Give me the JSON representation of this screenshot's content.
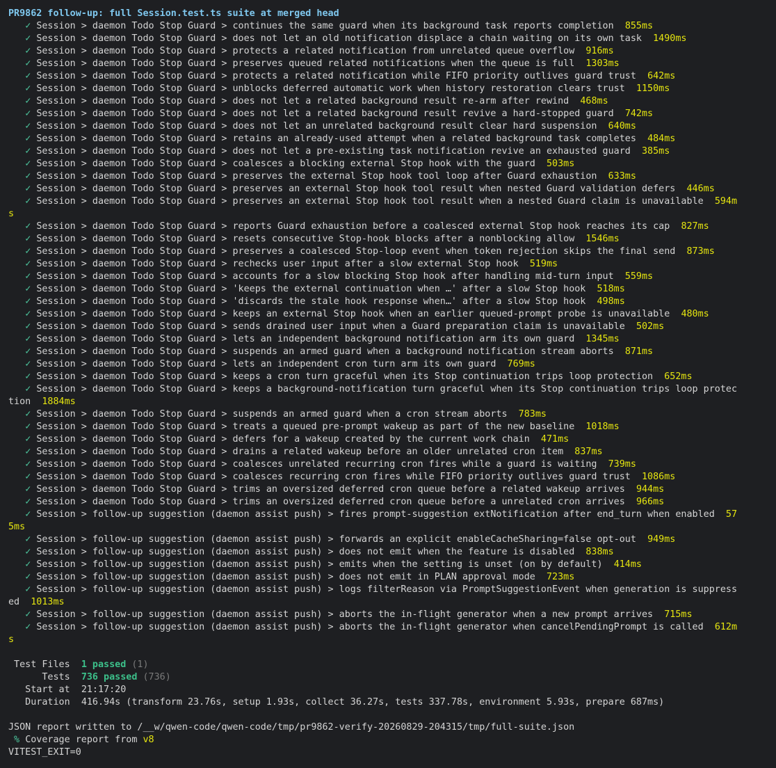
{
  "terminal": {
    "header": "PR9862 follow-up: full Session.test.ts suite at merged head",
    "check_glyph": "✓",
    "tests": [
      {
        "name": "Session > daemon Todo Stop Guard > continues the same guard when its background task reports completion",
        "ms": "855ms"
      },
      {
        "name": "Session > daemon Todo Stop Guard > does not let an old notification displace a chain waiting on its own task",
        "ms": "1490ms"
      },
      {
        "name": "Session > daemon Todo Stop Guard > protects a related notification from unrelated queue overflow",
        "ms": "916ms"
      },
      {
        "name": "Session > daemon Todo Stop Guard > preserves queued related notifications when the queue is full",
        "ms": "1303ms"
      },
      {
        "name": "Session > daemon Todo Stop Guard > protects a related notification while FIFO priority outlives guard trust",
        "ms": "642ms"
      },
      {
        "name": "Session > daemon Todo Stop Guard > unblocks deferred automatic work when history restoration clears trust",
        "ms": "1150ms"
      },
      {
        "name": "Session > daemon Todo Stop Guard > does not let a related background result re-arm after rewind",
        "ms": "468ms"
      },
      {
        "name": "Session > daemon Todo Stop Guard > does not let a related background result revive a hard-stopped guard",
        "ms": "742ms"
      },
      {
        "name": "Session > daemon Todo Stop Guard > does not let an unrelated background result clear hard suspension",
        "ms": "640ms"
      },
      {
        "name": "Session > daemon Todo Stop Guard > retains an already-used attempt when a related background task completes",
        "ms": "484ms"
      },
      {
        "name": "Session > daemon Todo Stop Guard > does not let a pre-existing task notification revive an exhausted guard",
        "ms": "385ms"
      },
      {
        "name": "Session > daemon Todo Stop Guard > coalesces a blocking external Stop hook with the guard",
        "ms": "503ms"
      },
      {
        "name": "Session > daemon Todo Stop Guard > preserves the external Stop hook tool loop after Guard exhaustion",
        "ms": "633ms"
      },
      {
        "name": "Session > daemon Todo Stop Guard > preserves an external Stop hook tool result when nested Guard validation defers",
        "ms": "446ms"
      },
      {
        "name": "Session > daemon Todo Stop Guard > preserves an external Stop hook tool result when a nested Guard claim is unavailable",
        "ms": "594m",
        "wrap_ms": "s"
      },
      {
        "name": "Session > daemon Todo Stop Guard > reports Guard exhaustion before a coalesced external Stop hook reaches its cap",
        "ms": "827ms"
      },
      {
        "name": "Session > daemon Todo Stop Guard > resets consecutive Stop-hook blocks after a nonblocking allow",
        "ms": "1546ms"
      },
      {
        "name": "Session > daemon Todo Stop Guard > preserves a coalesced Stop-loop event when token rejection skips the final send",
        "ms": "873ms"
      },
      {
        "name": "Session > daemon Todo Stop Guard > rechecks user input after a slow external Stop hook",
        "ms": "519ms"
      },
      {
        "name": "Session > daemon Todo Stop Guard > accounts for a slow blocking Stop hook after handling mid-turn input",
        "ms": "559ms"
      },
      {
        "name": "Session > daemon Todo Stop Guard > 'keeps the external continuation when …' after a slow Stop hook",
        "ms": "518ms"
      },
      {
        "name": "Session > daemon Todo Stop Guard > 'discards the stale hook response when…' after a slow Stop hook",
        "ms": "498ms"
      },
      {
        "name": "Session > daemon Todo Stop Guard > keeps an external Stop hook when an earlier queued-prompt probe is unavailable",
        "ms": "480ms"
      },
      {
        "name": "Session > daemon Todo Stop Guard > sends drained user input when a Guard preparation claim is unavailable",
        "ms": "502ms"
      },
      {
        "name": "Session > daemon Todo Stop Guard > lets an independent background notification arm its own guard",
        "ms": "1345ms"
      },
      {
        "name": "Session > daemon Todo Stop Guard > suspends an armed guard when a background notification stream aborts",
        "ms": "871ms"
      },
      {
        "name": "Session > daemon Todo Stop Guard > lets an independent cron turn arm its own guard",
        "ms": "769ms"
      },
      {
        "name": "Session > daemon Todo Stop Guard > keeps a cron turn graceful when its Stop continuation trips loop protection",
        "ms": "652ms"
      },
      {
        "name": "Session > daemon Todo Stop Guard > keeps a background-notification turn graceful when its Stop continuation trips loop protec",
        "ms": "",
        "wrap_text": "tion",
        "wrap_ms": "1884ms"
      },
      {
        "name": "Session > daemon Todo Stop Guard > suspends an armed guard when a cron stream aborts",
        "ms": "783ms"
      },
      {
        "name": "Session > daemon Todo Stop Guard > treats a queued pre-prompt wakeup as part of the new baseline",
        "ms": "1018ms"
      },
      {
        "name": "Session > daemon Todo Stop Guard > defers for a wakeup created by the current work chain",
        "ms": "471ms"
      },
      {
        "name": "Session > daemon Todo Stop Guard > drains a related wakeup before an older unrelated cron item",
        "ms": "837ms"
      },
      {
        "name": "Session > daemon Todo Stop Guard > coalesces unrelated recurring cron fires while a guard is waiting",
        "ms": "739ms"
      },
      {
        "name": "Session > daemon Todo Stop Guard > coalesces recurring cron fires while FIFO priority outlives guard trust",
        "ms": "1086ms"
      },
      {
        "name": "Session > daemon Todo Stop Guard > trims an oversized deferred cron queue before a related wakeup arrives",
        "ms": "944ms"
      },
      {
        "name": "Session > daemon Todo Stop Guard > trims an oversized deferred cron queue before a unrelated cron arrives",
        "ms": "966ms"
      },
      {
        "name": "Session > follow-up suggestion (daemon assist push) > fires prompt-suggestion extNotification after end_turn when enabled",
        "ms": "57",
        "wrap_ms": "5ms"
      },
      {
        "name": "Session > follow-up suggestion (daemon assist push) > forwards an explicit enableCacheSharing=false opt-out",
        "ms": "949ms"
      },
      {
        "name": "Session > follow-up suggestion (daemon assist push) > does not emit when the feature is disabled",
        "ms": "838ms"
      },
      {
        "name": "Session > follow-up suggestion (daemon assist push) > emits when the setting is unset (on by default)",
        "ms": "414ms"
      },
      {
        "name": "Session > follow-up suggestion (daemon assist push) > does not emit in PLAN approval mode",
        "ms": "723ms"
      },
      {
        "name": "Session > follow-up suggestion (daemon assist push) > logs filterReason via PromptSuggestionEvent when generation is suppress",
        "ms": "",
        "wrap_text": "ed",
        "wrap_ms": "1013ms"
      },
      {
        "name": "Session > follow-up suggestion (daemon assist push) > aborts the in-flight generator when a new prompt arrives",
        "ms": "715ms"
      },
      {
        "name": "Session > follow-up suggestion (daemon assist push) > aborts the in-flight generator when cancelPendingPrompt is called",
        "ms": "612m",
        "wrap_ms": "s"
      }
    ],
    "summary": {
      "test_files_label": " Test Files",
      "test_files_passed": "1 passed",
      "test_files_total": "(1)",
      "tests_label": "      Tests",
      "tests_passed": "736 passed",
      "tests_total": "(736)",
      "start_label": "   Start at",
      "start_value": "21:17:20",
      "duration_label": "   Duration",
      "duration_value": "416.94s (transform 23.76s, setup 1.93s, collect 36.27s, tests 337.78s, environment 5.93s, prepare 687ms)"
    },
    "json_report": "JSON report written to /__w/qwen-code/qwen-code/tmp/pr9862-verify-20260829-204315/tmp/full-suite.json",
    "coverage_prefix": " % ",
    "coverage_text": "Coverage report from ",
    "coverage_provider": "v8",
    "exit_line": "VITEST_EXIT=0"
  },
  "colors": {
    "background": "#1e1f22",
    "text": "#d4d4d4",
    "header": "#7fc8ef",
    "check": "#4ec9a0",
    "duration": "#e5e510",
    "pass": "#3cc08a",
    "dim": "#7a7a7a"
  }
}
